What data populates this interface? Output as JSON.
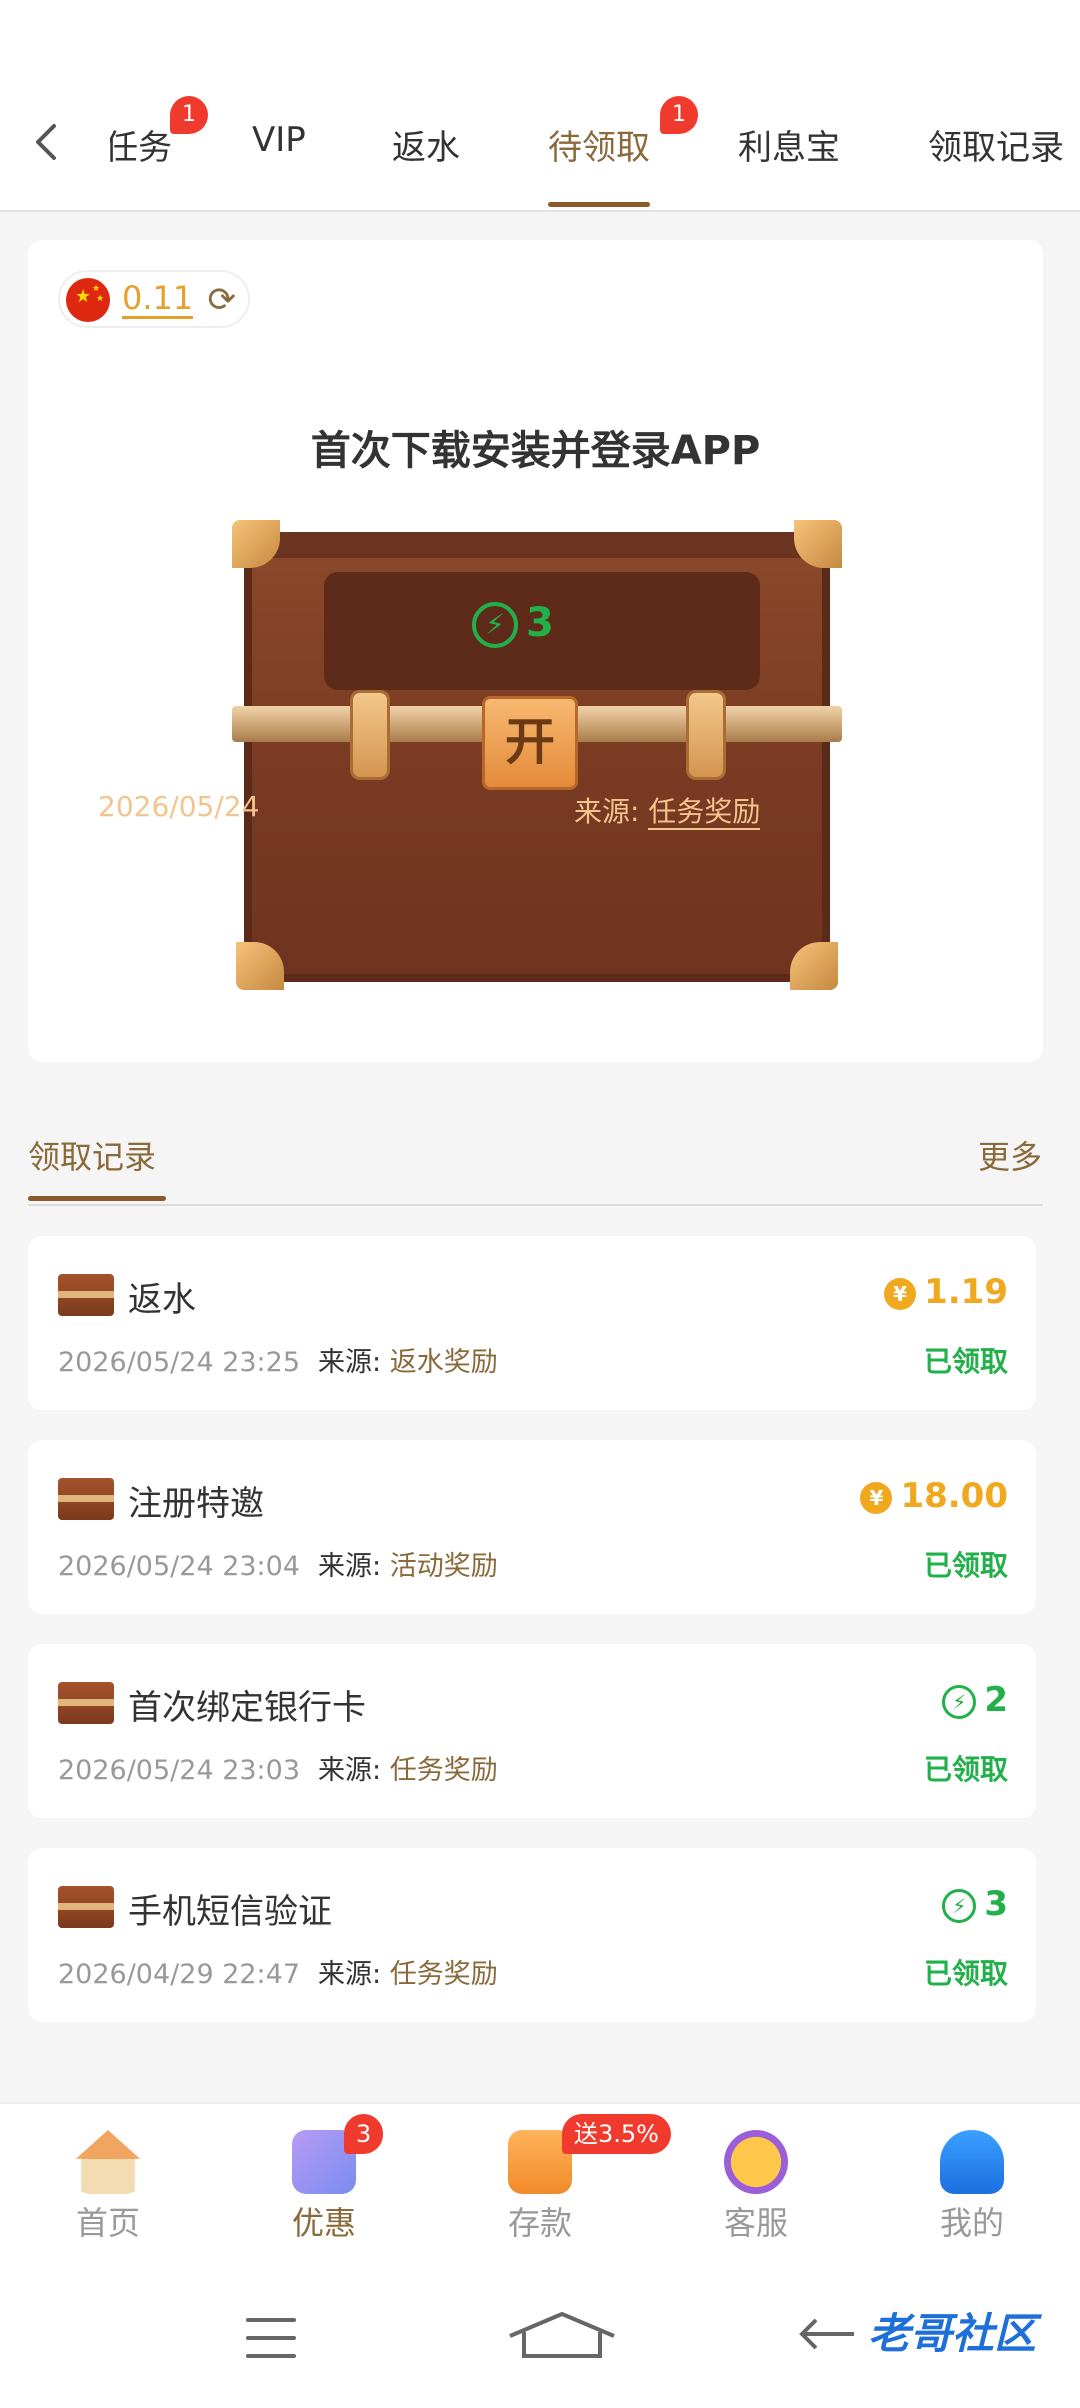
{
  "tabs": {
    "items": [
      {
        "label": "任务",
        "badge": "1"
      },
      {
        "label": "VIP"
      },
      {
        "label": "返水"
      },
      {
        "label": "待领取",
        "badge": "1",
        "active": true
      },
      {
        "label": "利息宝"
      },
      {
        "label": "领取记录"
      }
    ]
  },
  "balance": {
    "value": "0.11"
  },
  "chest_card": {
    "title": "首次下载安装并登录APP",
    "reward_amount": "3",
    "lock_label": "开",
    "date": "2026/05/24",
    "source_label": "来源:",
    "source_value": "任务奖励"
  },
  "records": {
    "title": "领取记录",
    "more": "更多",
    "items": [
      {
        "title": "返水",
        "time": "2026/05/24 23:25",
        "source_label": "来源:",
        "source": "返水奖励",
        "amount": "1.19",
        "currency_icon": "coin-icon",
        "status": "已领取"
      },
      {
        "title": "注册特邀",
        "time": "2026/05/24 23:04",
        "source_label": "来源:",
        "source": "活动奖励",
        "amount": "18.00",
        "currency_icon": "coin-icon",
        "status": "已领取"
      },
      {
        "title": "首次绑定银行卡",
        "time": "2026/05/24 23:03",
        "source_label": "来源:",
        "source": "任务奖励",
        "amount": "2",
        "currency_icon": "bolt-icon",
        "status": "已领取"
      },
      {
        "title": "手机短信验证",
        "time": "2026/04/29 22:47",
        "source_label": "来源:",
        "source": "任务奖励",
        "amount": "3",
        "currency_icon": "bolt-icon",
        "status": "已领取"
      }
    ]
  },
  "bottom_nav": {
    "items": [
      {
        "label": "首页"
      },
      {
        "label": "优惠",
        "badge": "3",
        "active": true
      },
      {
        "label": "存款",
        "badge": "送3.5%"
      },
      {
        "label": "客服"
      },
      {
        "label": "我的"
      }
    ]
  },
  "watermark": "老哥社区",
  "colors": {
    "accent": "#8a6a3a",
    "green": "#22b04a",
    "coin": "#f0a81e",
    "badge": "#f03a2e"
  }
}
